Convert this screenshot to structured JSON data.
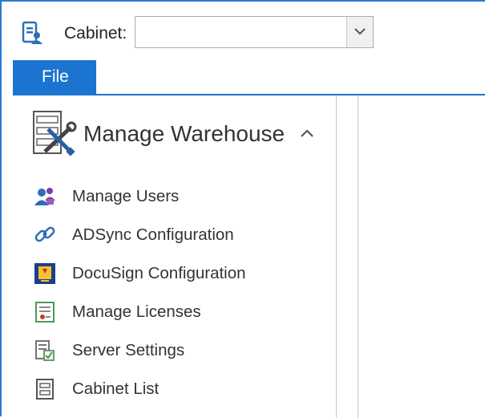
{
  "topbar": {
    "app_icon": "cabinet-user-icon",
    "cabinet_label": "Cabinet:",
    "cabinet_value": "",
    "dropdown_icon": "chevron-down-icon"
  },
  "menu": {
    "file_label": "File"
  },
  "nav": {
    "header_icon": "manage-warehouse-tools-icon",
    "header_title": "Manage Warehouse",
    "collapse_icon": "chevron-up-icon",
    "items": [
      {
        "label": "Manage Users",
        "icon": "users-icon"
      },
      {
        "label": "ADSync Configuration",
        "icon": "link-icon"
      },
      {
        "label": "DocuSign Configuration",
        "icon": "docusign-icon"
      },
      {
        "label": "Manage Licenses",
        "icon": "license-certificate-icon"
      },
      {
        "label": "Server Settings",
        "icon": "server-settings-icon"
      },
      {
        "label": "Cabinet List",
        "icon": "cabinet-list-icon"
      }
    ]
  },
  "colors": {
    "accent": "#1a74d0",
    "frame_border": "#2b7bd6"
  }
}
